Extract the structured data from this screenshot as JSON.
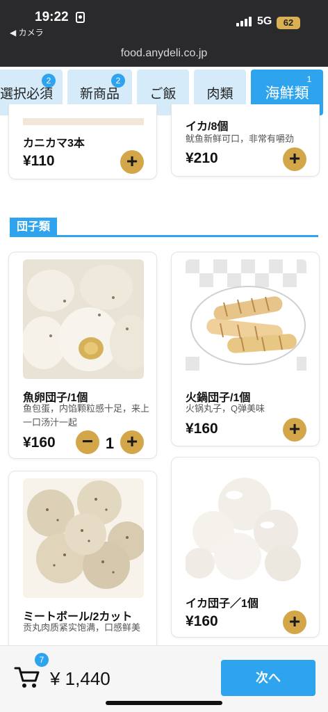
{
  "status": {
    "time": "19:22",
    "back_app": "◀ カメラ",
    "network": "5G",
    "battery": "62",
    "url": "food.anydeli.co.jp"
  },
  "tabs": [
    {
      "label": "選択必須",
      "badge": "2"
    },
    {
      "label": "新商品",
      "badge": "2"
    },
    {
      "label": "ご飯",
      "badge": ""
    },
    {
      "label": "肉類",
      "badge": ""
    },
    {
      "label": "海鮮類",
      "badge": "1",
      "active": true
    }
  ],
  "top_cards": [
    {
      "name": "カニカマ3本",
      "price": "¥110"
    },
    {
      "name": "イカ/8個",
      "desc": "鱿鱼新鲜可口，非常有嚼劲",
      "price": "¥210"
    }
  ],
  "section": {
    "title": "団子類"
  },
  "products": [
    {
      "name": "魚卵団子/1個",
      "desc": "鱼包蛋，内馅颗粒感十足，来上一口汤汁一起",
      "price": "¥160",
      "quantity": "1"
    },
    {
      "name": "火鍋団子/1個",
      "desc": "火锅丸子，Q弹美味",
      "price": "¥160"
    },
    {
      "name": "ミートボール/2カット",
      "desc": "贡丸肉质紧实饱满，口感鲜美",
      "price": ""
    },
    {
      "name": "イカ団子／1個",
      "price": "¥160"
    }
  ],
  "cart": {
    "count": "7",
    "total": "¥ 1,440",
    "next_label": "次へ"
  },
  "colors": {
    "accent": "#2ea3ee",
    "button": "#d4a64a",
    "tab_bg": "#d6ebfa"
  }
}
